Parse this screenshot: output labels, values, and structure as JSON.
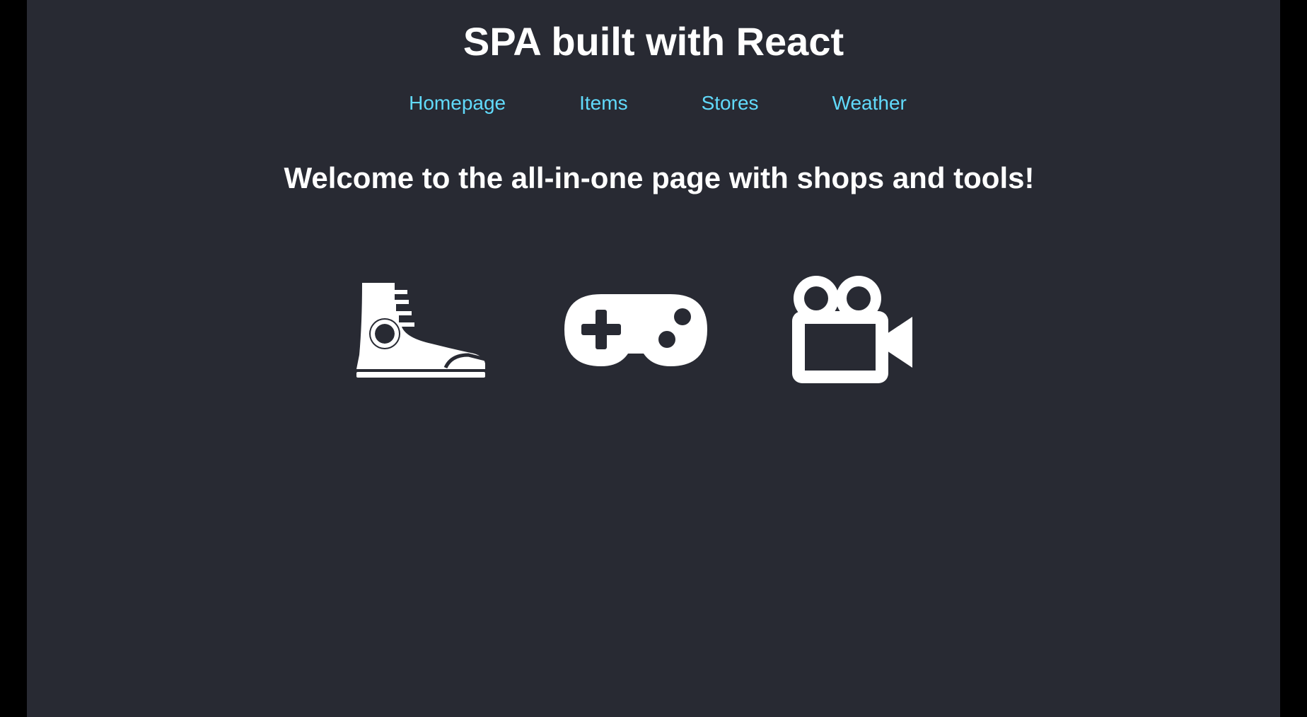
{
  "header": {
    "title": "SPA built with React"
  },
  "nav": {
    "items": [
      {
        "label": "Homepage"
      },
      {
        "label": "Items"
      },
      {
        "label": "Stores"
      },
      {
        "label": "Weather"
      }
    ],
    "link_color": "#61dafb"
  },
  "main": {
    "welcome": "Welcome to the all-in-one page with shops and tools!",
    "icons": [
      {
        "name": "sneaker-icon"
      },
      {
        "name": "gamepad-icon"
      },
      {
        "name": "video-camera-icon"
      }
    ]
  },
  "colors": {
    "background": "#282a33",
    "text": "#ffffff",
    "frame": "#000000"
  }
}
